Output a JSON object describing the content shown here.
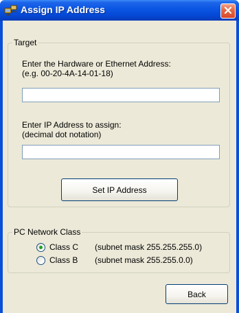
{
  "window": {
    "title": "Assign IP Address"
  },
  "target": {
    "legend": "Target",
    "hw_label_line1": "Enter the Hardware or Ethernet Address:",
    "hw_label_line2": "(e.g. 00-20-4A-14-01-18)",
    "hw_value": "",
    "ip_label_line1": "Enter IP Address to assign:",
    "ip_label_line2": "(decimal dot notation)",
    "ip_value": "",
    "set_button": "Set IP Address"
  },
  "network_class": {
    "legend": "PC Network Class",
    "options": [
      {
        "label": "Class C",
        "mask": "(subnet mask 255.255.255.0)",
        "selected": true
      },
      {
        "label": "Class B",
        "mask": "(subnet mask 255.255.0.0)",
        "selected": false
      }
    ]
  },
  "footer": {
    "back_button": "Back"
  },
  "icons": {
    "app": "network-tool-icon",
    "close": "close-icon"
  },
  "colors": {
    "titlebar": "#0a55e2",
    "close_button": "#e56a45",
    "face": "#ece9d8",
    "radio_selected": "#21a121"
  }
}
